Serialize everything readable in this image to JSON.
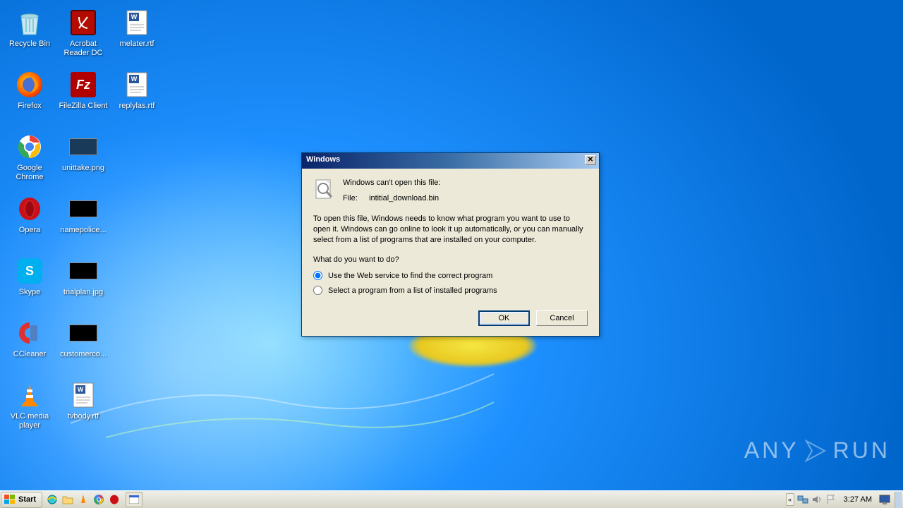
{
  "desktop": {
    "icons_col1": [
      {
        "label": "Recycle Bin",
        "kind": "recycle"
      },
      {
        "label": "Firefox",
        "kind": "firefox"
      },
      {
        "label": "Google Chrome",
        "kind": "chrome"
      },
      {
        "label": "Opera",
        "kind": "opera"
      },
      {
        "label": "Skype",
        "kind": "skype"
      },
      {
        "label": "CCleaner",
        "kind": "ccleaner"
      },
      {
        "label": "VLC media player",
        "kind": "vlc"
      }
    ],
    "icons_col2": [
      {
        "label": "Acrobat Reader DC",
        "kind": "acrobat"
      },
      {
        "label": "FileZilla Client",
        "kind": "filezilla"
      },
      {
        "label": "unittake.png",
        "kind": "png"
      },
      {
        "label": "namepolice...",
        "kind": "thumb"
      },
      {
        "label": "trialplan.jpg",
        "kind": "thumb"
      },
      {
        "label": "customerco...",
        "kind": "thumb"
      },
      {
        "label": "tvbody.rtf",
        "kind": "rtf"
      }
    ],
    "icons_col3": [
      {
        "label": "melater.rtf",
        "kind": "rtf"
      },
      {
        "label": "replylas.rtf",
        "kind": "rtf"
      }
    ]
  },
  "dialog": {
    "title": "Windows",
    "heading": "Windows can't open this file:",
    "file_label": "File:",
    "file_name": "intitial_download.bin",
    "description": "To open this file, Windows needs to know what program you want to use to open it. Windows can go online to look it up automatically, or you can manually select from a list of programs that are installed on your computer.",
    "question": "What do you want to do?",
    "option_web": "Use the Web service to find the correct program",
    "option_list": "Select a program from a list of installed programs",
    "ok": "OK",
    "cancel": "Cancel"
  },
  "taskbar": {
    "start": "Start",
    "clock": "3:27 AM"
  },
  "watermark": {
    "text_left": "ANY",
    "text_right": "RUN"
  }
}
